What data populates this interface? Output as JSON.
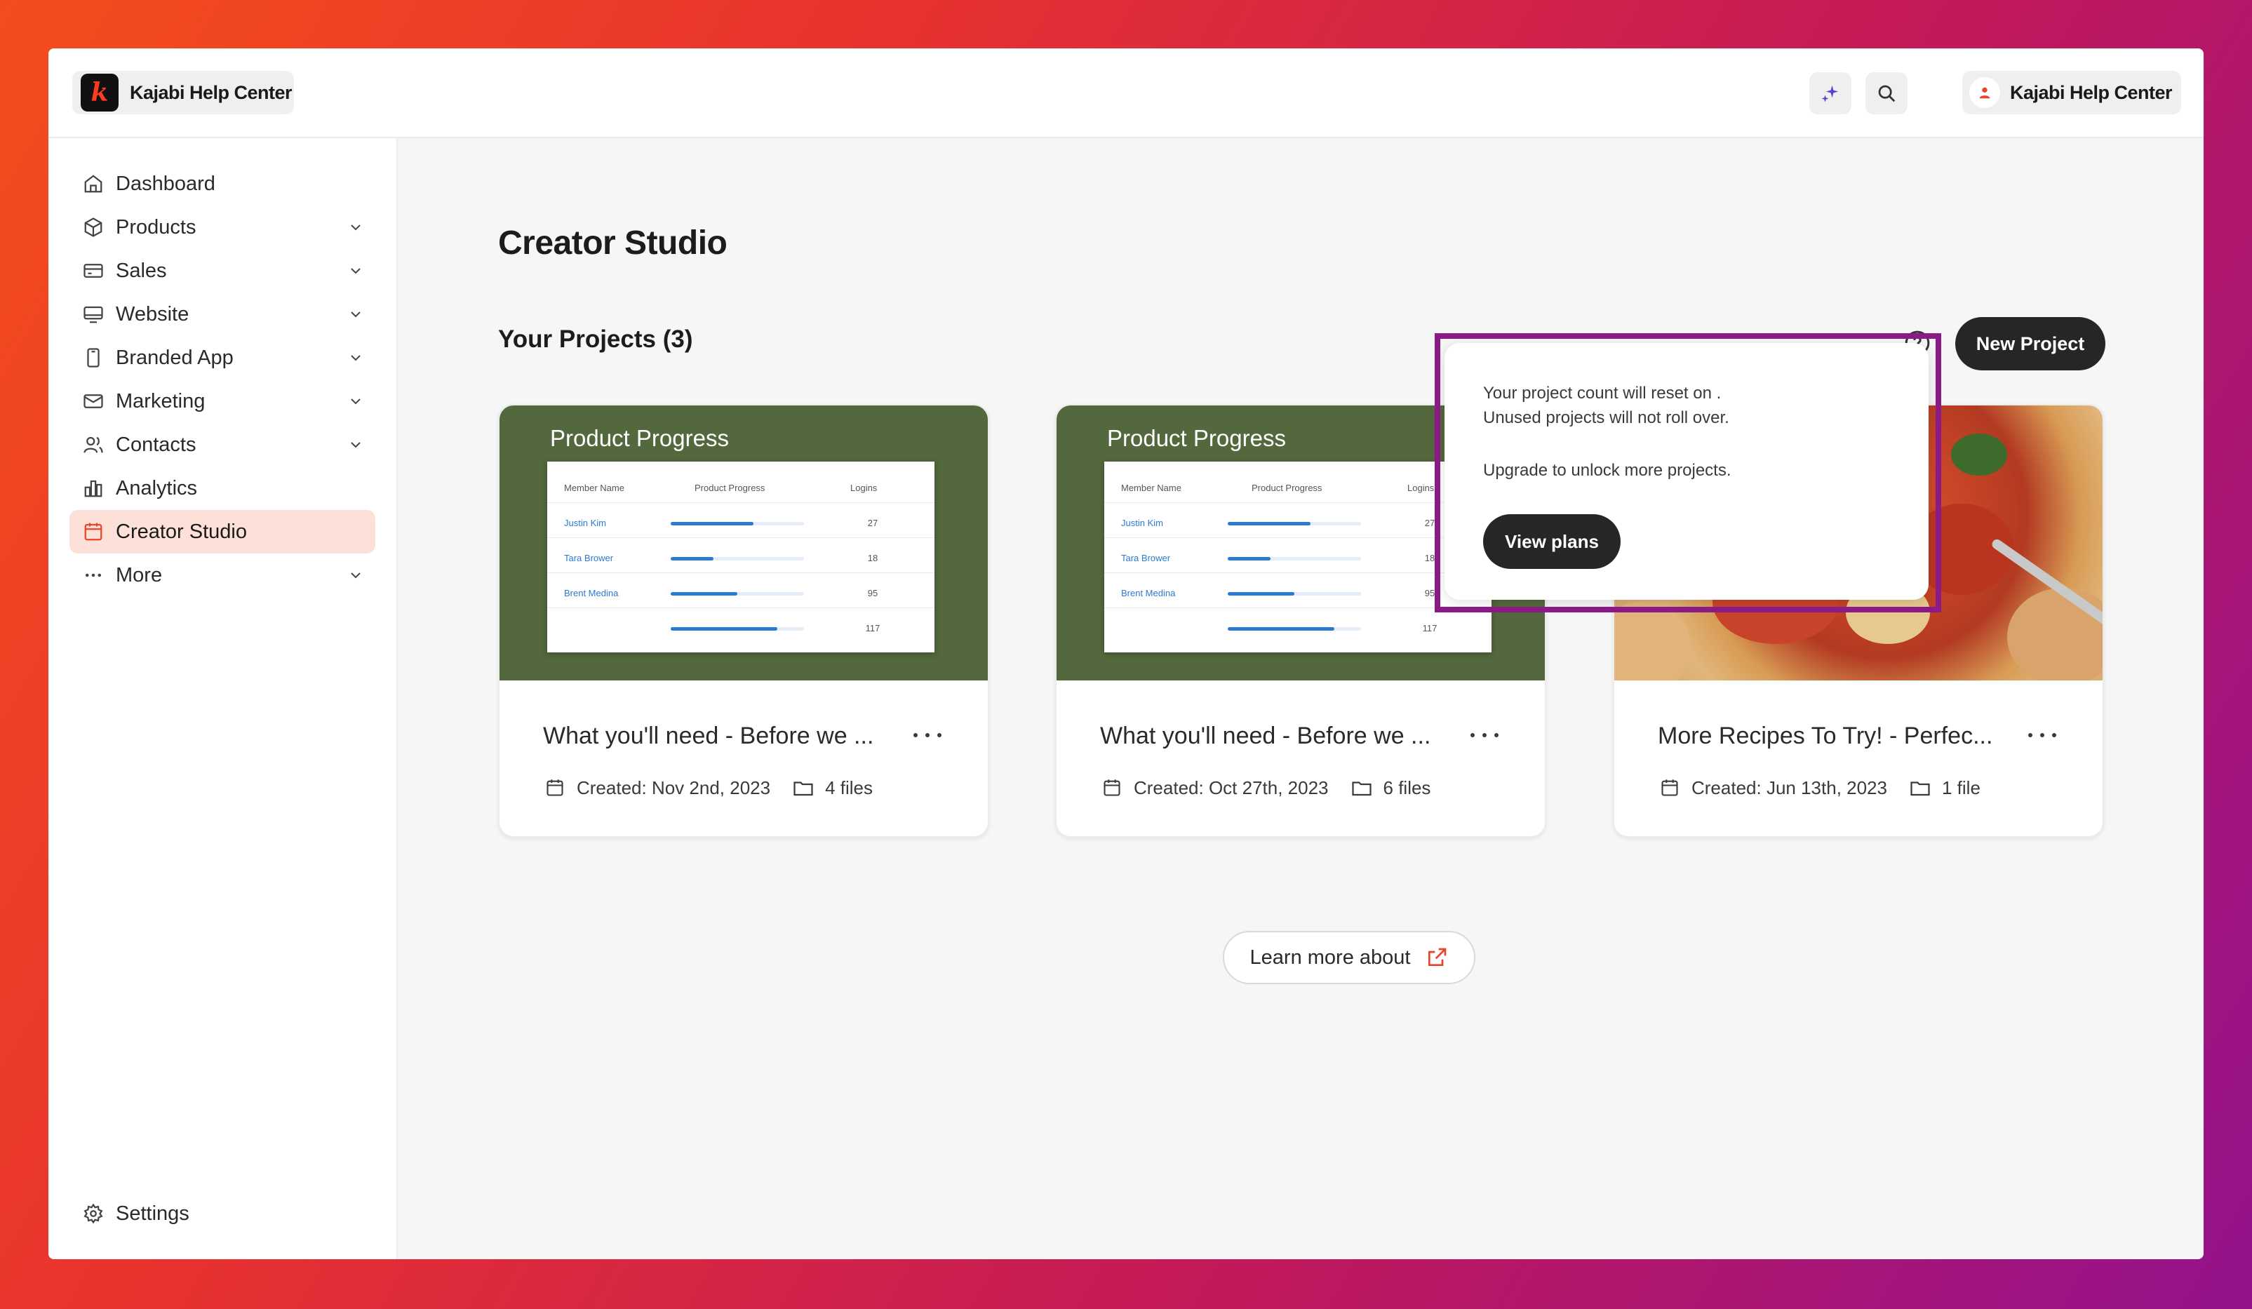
{
  "topbar": {
    "brand_name": "Kajabi Help Center",
    "brand_logo_letter": "k",
    "account_name": "Kajabi Help Center",
    "icons": [
      "sparkle-icon",
      "search-icon",
      "user-icon"
    ]
  },
  "sidebar": {
    "items": [
      {
        "label": "Dashboard",
        "icon": "home-icon",
        "has_chevron": false,
        "active": false
      },
      {
        "label": "Products",
        "icon": "box-icon",
        "has_chevron": true,
        "active": false
      },
      {
        "label": "Sales",
        "icon": "credit-card-icon",
        "has_chevron": true,
        "active": false
      },
      {
        "label": "Website",
        "icon": "monitor-icon",
        "has_chevron": true,
        "active": false
      },
      {
        "label": "Branded App",
        "icon": "phone-icon",
        "has_chevron": true,
        "active": false
      },
      {
        "label": "Marketing",
        "icon": "mail-icon",
        "has_chevron": true,
        "active": false
      },
      {
        "label": "Contacts",
        "icon": "contacts-icon",
        "has_chevron": true,
        "active": false
      },
      {
        "label": "Analytics",
        "icon": "bar-chart-icon",
        "has_chevron": false,
        "active": false
      },
      {
        "label": "Creator Studio",
        "icon": "calendar-icon",
        "has_chevron": false,
        "active": true
      },
      {
        "label": "More",
        "icon": "ellipsis-icon",
        "has_chevron": true,
        "active": false
      }
    ],
    "settings_label": "Settings"
  },
  "main": {
    "page_title": "Creator Studio",
    "section_title": "Your Projects (3)",
    "new_project_label": "New Project",
    "learn_more_label": "Learn more about"
  },
  "popover": {
    "line1": " Your project count will reset on .",
    "line2": "Unused projects will not roll over.",
    "line3": "Upgrade to unlock more projects.",
    "button_label": "View plans"
  },
  "cards": [
    {
      "thumb_title": "Product Progress",
      "title": "What you'll need - Before we ...",
      "created": "Created: Nov 2nd, 2023",
      "files": "4 files",
      "table": {
        "headers": [
          "Member Name",
          "Product Progress",
          "Logins"
        ],
        "rows": [
          {
            "name": "Justin Kim",
            "progress": 0.62,
            "logins": "27"
          },
          {
            "name": "Tara Brower",
            "progress": 0.32,
            "logins": "18"
          },
          {
            "name": "Brent Medina",
            "progress": 0.5,
            "logins": "95"
          },
          {
            "name": "",
            "progress": 0.8,
            "logins": "117"
          }
        ]
      }
    },
    {
      "thumb_title": "Product Progress",
      "title": "What you'll need - Before we ...",
      "created": "Created: Oct 27th, 2023",
      "files": "6 files",
      "table": {
        "headers": [
          "Member Name",
          "Product Progress",
          "Logins"
        ],
        "rows": [
          {
            "name": "Justin Kim",
            "progress": 0.62,
            "logins": "27"
          },
          {
            "name": "Tara Brower",
            "progress": 0.32,
            "logins": "18"
          },
          {
            "name": "Brent Medina",
            "progress": 0.5,
            "logins": "95"
          },
          {
            "name": "",
            "progress": 0.8,
            "logins": "117"
          }
        ]
      }
    },
    {
      "thumb_title": "",
      "title": "More Recipes To Try! - Perfec...",
      "created": "Created: Jun 13th, 2023",
      "files": "1 file"
    }
  ],
  "colors": {
    "accent": "#e8442a",
    "active_bg": "#fde1d8",
    "thumb_green": "#53683c",
    "dark_button": "#262626",
    "highlight": "#8c1a86",
    "link_blue": "#2b7ad1"
  }
}
